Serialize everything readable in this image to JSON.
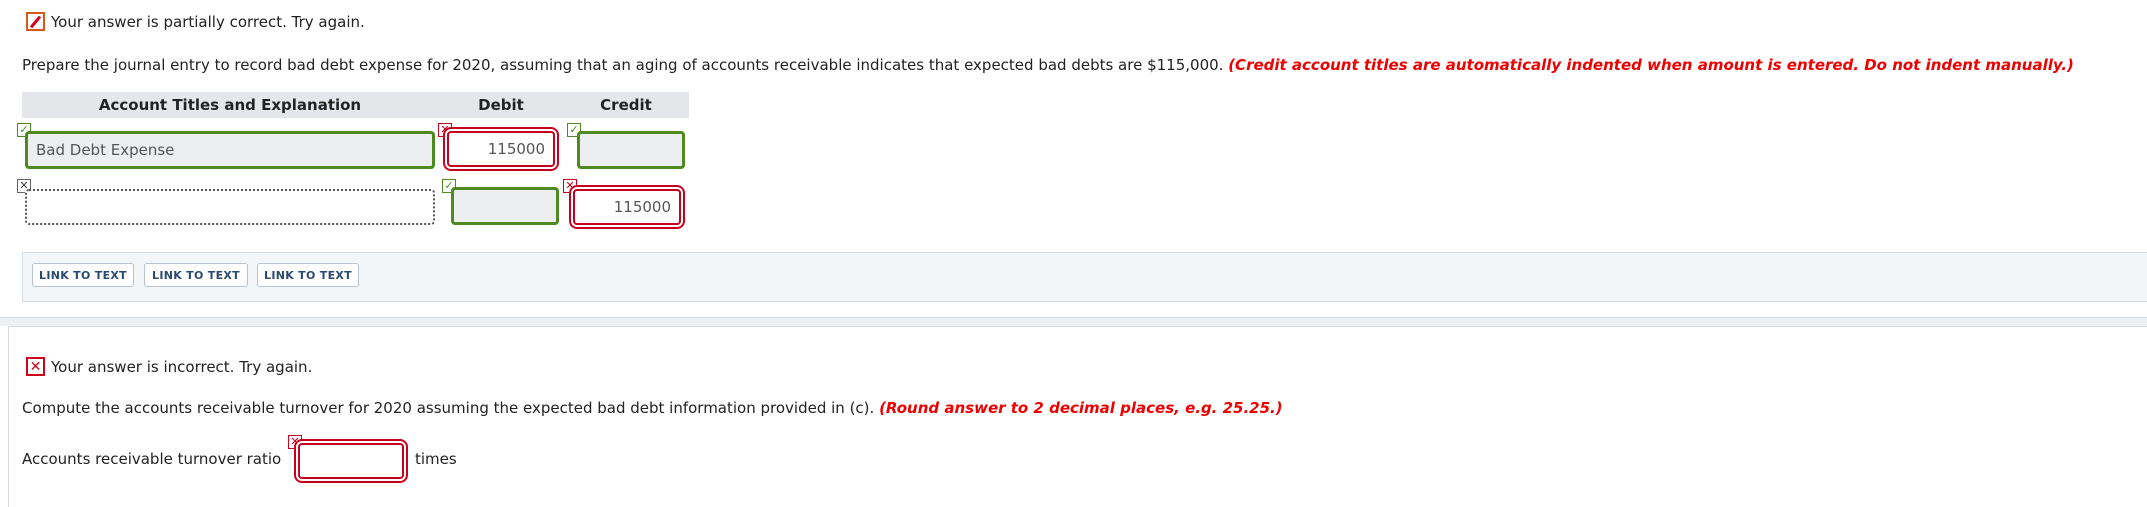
{
  "section_c": {
    "status_text": "Your answer is partially correct.  Try again.",
    "prompt_text": "Prepare the journal entry to record bad debt expense for 2020, assuming that an aging of accounts receivable indicates that expected bad debts are $115,000.",
    "prompt_note": "(Credit account titles are automatically indented when amount is entered. Do not indent manually.)",
    "table": {
      "headers": [
        "Account Titles and Explanation",
        "Debit",
        "Credit"
      ],
      "rows": [
        {
          "account": "Bad Debt Expense",
          "debit": "115000",
          "credit": ""
        },
        {
          "account": "",
          "debit": "",
          "credit": "115000"
        }
      ]
    },
    "links": [
      "LINK TO TEXT",
      "LINK TO TEXT",
      "LINK TO TEXT"
    ]
  },
  "section_d": {
    "status_text": "Your answer is incorrect.  Try again.",
    "prompt_text": "Compute the accounts receivable turnover for 2020 assuming the expected bad debt information provided in (c).",
    "prompt_note": "(Round answer to 2 decimal places, e.g. 25.25.)",
    "field_label": "Accounts receivable turnover ratio",
    "field_value": "",
    "unit_label": "times"
  },
  "colors": {
    "correct": "#4e8a1f",
    "incorrect": "#c8001f",
    "note_red": "#e00000",
    "link_text": "#2b4a72"
  },
  "icons": {
    "partial": "pencil-icon",
    "incorrect": "x-icon",
    "correct_mark": "check-icon",
    "wrong_mark": "x-icon"
  }
}
